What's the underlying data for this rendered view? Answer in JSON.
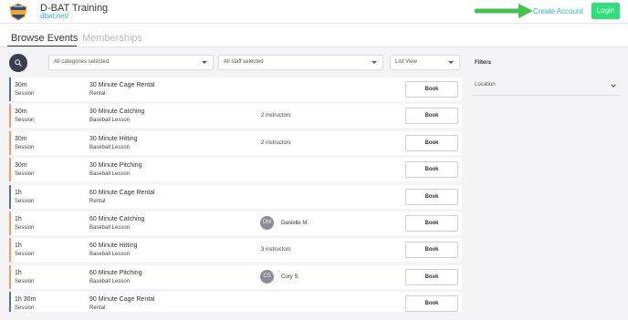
{
  "header": {
    "brand_name": "D-BAT Training",
    "brand_url": "dbat.net/",
    "create_account": "Create Account",
    "login": "Login",
    "accent_color": "#2de07a",
    "link_color": "#29b6c8"
  },
  "tabs": {
    "browse": "Browse Events",
    "memberships": "Memberships"
  },
  "toolbar": {
    "search_icon": "search-icon",
    "categories": "All categories selected",
    "staff": "All staff selected",
    "view": "List View"
  },
  "filters": {
    "title": "Filters",
    "location": "Location"
  },
  "events": [
    {
      "duration": "30m",
      "type": "Session",
      "name": "30 Minute Cage Rental",
      "category": "Rental",
      "book": "Book"
    },
    {
      "duration": "30m",
      "type": "Session",
      "name": "30 Minute Catching",
      "category": "Baseball Lesson",
      "instructors": "2 instructors",
      "book": "Book"
    },
    {
      "duration": "30m",
      "type": "Session",
      "name": "30 Minute Hitting",
      "category": "Baseball Lesson",
      "instructors": "2 instructors",
      "book": "Book"
    },
    {
      "duration": "30m",
      "type": "Session",
      "name": "30 Minute Pitching",
      "category": "Baseball Lesson",
      "book": "Book"
    },
    {
      "duration": "1h",
      "type": "Session",
      "name": "60 Minute Cage Rental",
      "category": "Rental",
      "book": "Book"
    },
    {
      "duration": "1h",
      "type": "Session",
      "name": "60 Minute Catching",
      "category": "Baseball Lesson",
      "staff_initials": "DM",
      "staff_name": "Danielle M.",
      "book": "Book"
    },
    {
      "duration": "1h",
      "type": "Session",
      "name": "60 Minute Hitting",
      "category": "Baseball Lesson",
      "instructors": "3 instructors",
      "book": "Book"
    },
    {
      "duration": "1h",
      "type": "Session",
      "name": "60 Minute Pitching",
      "category": "Baseball Lesson",
      "staff_initials": "CS",
      "staff_name": "Cory S.",
      "book": "Book"
    },
    {
      "duration": "1h 30m",
      "type": "Session",
      "name": "90 Minute Cage Rental",
      "category": "Rental",
      "book": "Book"
    }
  ]
}
